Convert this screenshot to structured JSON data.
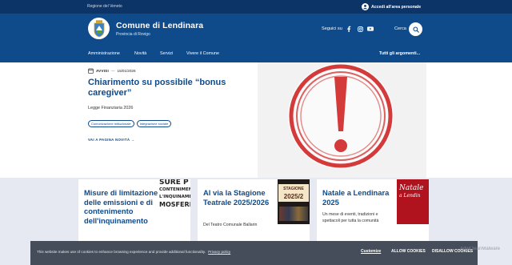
{
  "slim": {
    "region": "Regione del Veneto",
    "login": "Accedi all'area personale"
  },
  "header": {
    "title": "Comune di Lendinara",
    "subtitle": "Provincia di Rovigo",
    "follow": "Seguici su",
    "search": "Cerca"
  },
  "nav": {
    "items": [
      "Amministrazione",
      "Novità",
      "Servizi",
      "Vivere il Comune"
    ],
    "all": "Tutti gli argomenti..."
  },
  "hero": {
    "category": "AVVISI",
    "date": "15/01/2026",
    "title": "Chiarimento su possibile “bonus caregiver”",
    "description": "Legge Finanziaria 2026",
    "chips": [
      "Comunicazione istituzionale",
      "Integrazione sociale"
    ],
    "more": "VAI A PAGINA NOVITÀ"
  },
  "cards": [
    {
      "title": "Misure di limitazione delle emissioni e di contenimento dell'inquinamento",
      "description": "",
      "thumb_lines": [
        "SURE P",
        "CONTENIMEN",
        "L'INQUINAMEN",
        "MOSFERI"
      ]
    },
    {
      "title": "Al via la Stagione Teatrale 2025/2026",
      "description": "Del Teatro Comunale Ballarin",
      "thumb_lines": [
        "STAGIONE",
        "2025/2"
      ]
    },
    {
      "title": "Natale a Lendinara 2025",
      "description": "Un mese di eventi, tradizioni e spettacoli per tutta la comunità",
      "thumb_lines": [
        "Natale",
        "a Lendin"
      ]
    }
  ],
  "cookie": {
    "text": "This website makes use of cookies to enhance browsing experience and provide additional functionality.",
    "privacy": "Privacy policy",
    "customize": "Customize",
    "allow": "ALLOW COOKIES",
    "disallow": "DISALLOW COOKIES"
  },
  "watermark": "AdwCleanMalware",
  "colors": {
    "primary": "#0f4a8a",
    "dark_top": "#0c3466",
    "cards_bg": "#e6e9f2",
    "cookie_bg": "#454d5a",
    "alert_red": "#d43a3a"
  }
}
